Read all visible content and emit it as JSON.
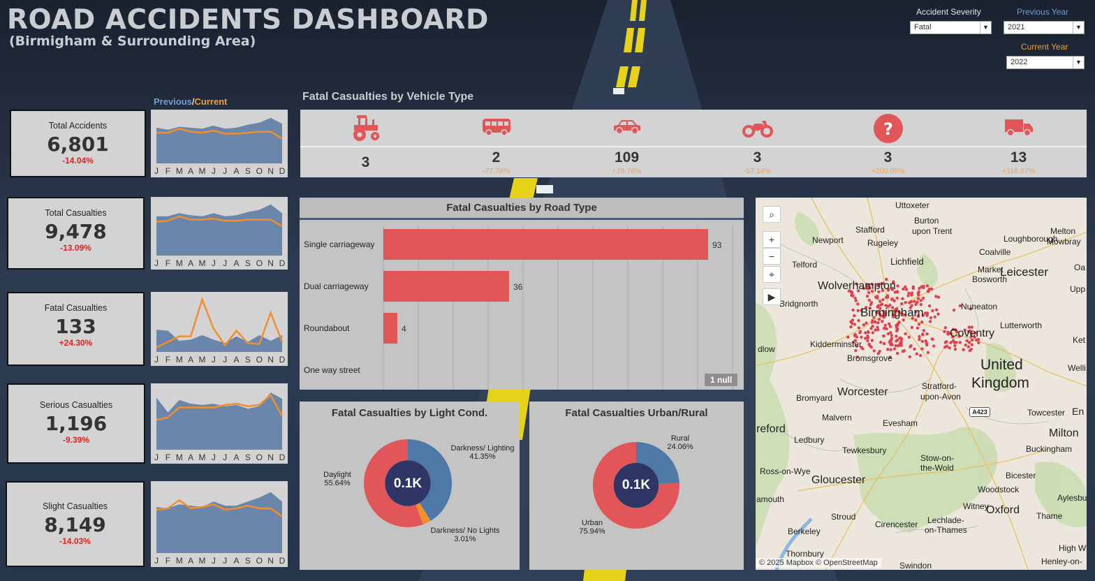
{
  "header": {
    "title": "ROAD ACCIDENTS DASHBOARD",
    "subtitle": "(Birmigham & Surrounding Area)"
  },
  "filters": {
    "severity": {
      "label": "Accident Severity",
      "value": "Fatal"
    },
    "previous_year": {
      "label": "Previous Year",
      "value": "2021"
    },
    "current_year": {
      "label": "Current Year",
      "value": "2022"
    }
  },
  "legend": {
    "previous": "Previous",
    "sep": "/",
    "current": "Current"
  },
  "months": [
    "J",
    "F",
    "M",
    "A",
    "M",
    "J",
    "J",
    "A",
    "S",
    "O",
    "N",
    "D"
  ],
  "kpis": [
    {
      "title": "Total Accidents",
      "value": "6,801",
      "change": "-14.04%",
      "prev": [
        0.72,
        0.68,
        0.74,
        0.72,
        0.7,
        0.76,
        0.7,
        0.72,
        0.78,
        0.82,
        0.92,
        0.8
      ],
      "curr": [
        0.62,
        0.62,
        0.7,
        0.64,
        0.62,
        0.66,
        0.6,
        0.6,
        0.62,
        0.64,
        0.64,
        0.5
      ]
    },
    {
      "title": "Total Casualties",
      "value": "9,478",
      "change": "-13.09%",
      "prev": [
        0.72,
        0.72,
        0.78,
        0.74,
        0.72,
        0.78,
        0.72,
        0.74,
        0.8,
        0.84,
        0.94,
        0.78
      ],
      "curr": [
        0.62,
        0.64,
        0.72,
        0.66,
        0.66,
        0.68,
        0.64,
        0.64,
        0.66,
        0.66,
        0.66,
        0.54
      ]
    },
    {
      "title": "Fatal Casualties",
      "value": "133",
      "change": "+24.30%",
      "prev": [
        0.4,
        0.38,
        0.2,
        0.22,
        0.3,
        0.22,
        0.16,
        0.28,
        0.18,
        0.3,
        0.2,
        0.3
      ],
      "curr": [
        0.08,
        0.18,
        0.28,
        0.28,
        0.94,
        0.42,
        0.12,
        0.38,
        0.16,
        0.14,
        0.7,
        0.18
      ]
    },
    {
      "title": "Serious Casualties",
      "value": "1,196",
      "change": "-9.39%",
      "prev": [
        0.84,
        0.6,
        0.8,
        0.74,
        0.72,
        0.74,
        0.7,
        0.72,
        0.66,
        0.7,
        0.92,
        0.82
      ],
      "curr": [
        0.48,
        0.52,
        0.68,
        0.68,
        0.68,
        0.68,
        0.72,
        0.74,
        0.7,
        0.72,
        0.88,
        0.54
      ]
    },
    {
      "title": "Slight Casualties",
      "value": "8,149",
      "change": "-14.03%",
      "prev": [
        0.68,
        0.66,
        0.72,
        0.7,
        0.68,
        0.76,
        0.7,
        0.7,
        0.76,
        0.82,
        0.9,
        0.76
      ],
      "curr": [
        0.64,
        0.66,
        0.78,
        0.66,
        0.68,
        0.72,
        0.64,
        0.66,
        0.7,
        0.66,
        0.66,
        0.54
      ]
    }
  ],
  "vehicle": {
    "title": "Fatal Casualties by Vehicle Type",
    "items": [
      {
        "icon": "tractor-icon",
        "value": "3",
        "change": ""
      },
      {
        "icon": "bus-icon",
        "value": "2",
        "change": "-77.78%"
      },
      {
        "icon": "car-icon",
        "value": "109",
        "change": "+29.76%"
      },
      {
        "icon": "motorcycle-icon",
        "value": "3",
        "change": "-57.14%"
      },
      {
        "icon": "question-icon",
        "value": "3",
        "change": "+200.00%"
      },
      {
        "icon": "truck-icon",
        "value": "13",
        "change": "+116.67%"
      }
    ]
  },
  "chart_data": [
    {
      "type": "bar",
      "title": "Fatal Casualties by Road Type",
      "categories": [
        "Single carriageway",
        "Dual carriageway",
        "Roundabout",
        "One way street"
      ],
      "values": [
        93,
        36,
        4,
        null
      ],
      "xlim": [
        0,
        100
      ],
      "null_badge": "1 null"
    },
    {
      "type": "pie",
      "title": "Fatal Casualties by Light Cond.",
      "center_label": "0.1K",
      "slices": [
        {
          "label": "Darkness/ Lighting",
          "pct": "41.35%",
          "value": 41.35,
          "color": "#4e79a7"
        },
        {
          "label": "Darkness/ No Lights",
          "pct": "3.01%",
          "value": 3.01,
          "color": "#f28e2b"
        },
        {
          "label": "Daylight",
          "pct": "55.64%",
          "value": 55.64,
          "color": "#e15759"
        }
      ]
    },
    {
      "type": "pie",
      "title": "Fatal Casualties Urban/Rural",
      "center_label": "0.1K",
      "slices": [
        {
          "label": "Rural",
          "pct": "24.06%",
          "value": 24.06,
          "color": "#4e79a7"
        },
        {
          "label": "Urban",
          "pct": "75.94%",
          "value": 75.94,
          "color": "#e15759"
        }
      ]
    }
  ],
  "map": {
    "attribution": "© 2025 Mapbox © OpenStreetMap",
    "labels": [
      {
        "t": "Uttoxeter",
        "x": 200,
        "y": 4,
        "s": 12
      },
      {
        "t": "Stafford",
        "x": 143,
        "y": 39,
        "s": 12
      },
      {
        "t": "Burton",
        "x": 227,
        "y": 26,
        "s": 12
      },
      {
        "t": "upon Trent",
        "x": 224,
        "y": 41,
        "s": 12
      },
      {
        "t": "Melton",
        "x": 422,
        "y": 41,
        "s": 12
      },
      {
        "t": "Mowbray",
        "x": 417,
        "y": 56,
        "s": 12
      },
      {
        "t": "Newport",
        "x": 81,
        "y": 54,
        "s": 12
      },
      {
        "t": "Rugeley",
        "x": 160,
        "y": 58,
        "s": 12
      },
      {
        "t": "Loughborough",
        "x": 355,
        "y": 52,
        "s": 12
      },
      {
        "t": "Coalville",
        "x": 320,
        "y": 71,
        "s": 12
      },
      {
        "t": "Lichfield",
        "x": 193,
        "y": 84,
        "s": 13
      },
      {
        "t": "Telford",
        "x": 52,
        "y": 89,
        "s": 12
      },
      {
        "t": "Market",
        "x": 318,
        "y": 96,
        "s": 12
      },
      {
        "t": "Bosworth",
        "x": 310,
        "y": 110,
        "s": 12
      },
      {
        "t": "Leicester",
        "x": 350,
        "y": 97,
        "s": 17
      },
      {
        "t": "Oa",
        "x": 456,
        "y": 93,
        "s": 12
      },
      {
        "t": "Wolverhampton",
        "x": 89,
        "y": 118,
        "s": 16
      },
      {
        "t": "Upp",
        "x": 450,
        "y": 124,
        "s": 12
      },
      {
        "t": "Bridgnorth",
        "x": 34,
        "y": 145,
        "s": 12
      },
      {
        "t": "Nuneaton",
        "x": 294,
        "y": 149,
        "s": 12
      },
      {
        "t": "Birmingham",
        "x": 150,
        "y": 155,
        "s": 17
      },
      {
        "t": "Lutterworth",
        "x": 350,
        "y": 176,
        "s": 12
      },
      {
        "t": "Coventry",
        "x": 278,
        "y": 186,
        "s": 16
      },
      {
        "t": "Ket",
        "x": 454,
        "y": 197,
        "s": 12
      },
      {
        "t": "Kidderminster",
        "x": 78,
        "y": 203,
        "s": 12
      },
      {
        "t": "dlow",
        "x": 3,
        "y": 210,
        "s": 12
      },
      {
        "t": "Bromsgrove",
        "x": 131,
        "y": 223,
        "s": 12
      },
      {
        "t": "United",
        "x": 322,
        "y": 228,
        "s": 21
      },
      {
        "t": "Kingdom",
        "x": 309,
        "y": 254,
        "s": 21
      },
      {
        "t": "Welli",
        "x": 447,
        "y": 237,
        "s": 12
      },
      {
        "t": "Stratford-",
        "x": 238,
        "y": 263,
        "s": 12
      },
      {
        "t": "upon-Avon",
        "x": 236,
        "y": 278,
        "s": 12
      },
      {
        "t": "Bromyard",
        "x": 58,
        "y": 280,
        "s": 12
      },
      {
        "t": "Worcester",
        "x": 117,
        "y": 270,
        "s": 16
      },
      {
        "t": "Towcester",
        "x": 389,
        "y": 301,
        "s": 12
      },
      {
        "t": "En",
        "x": 453,
        "y": 298,
        "s": 14
      },
      {
        "t": "Malvern",
        "x": 95,
        "y": 308,
        "s": 12
      },
      {
        "t": "reford",
        "x": 1,
        "y": 323,
        "s": 16
      },
      {
        "t": "Evesham",
        "x": 182,
        "y": 316,
        "s": 12
      },
      {
        "t": "Milton",
        "x": 420,
        "y": 329,
        "s": 16
      },
      {
        "t": "Ledbury",
        "x": 55,
        "y": 340,
        "s": 12
      },
      {
        "t": "Tewkesbury",
        "x": 124,
        "y": 355,
        "s": 12
      },
      {
        "t": "Buckingham",
        "x": 387,
        "y": 353,
        "s": 12
      },
      {
        "t": "Stow-on-",
        "x": 236,
        "y": 366,
        "s": 12
      },
      {
        "t": "the-Wold",
        "x": 236,
        "y": 380,
        "s": 12
      },
      {
        "t": "Ross-on-Wye",
        "x": 6,
        "y": 385,
        "s": 12
      },
      {
        "t": "Bicester",
        "x": 358,
        "y": 391,
        "s": 12
      },
      {
        "t": "Gloucester",
        "x": 80,
        "y": 396,
        "s": 16
      },
      {
        "t": "Woodstock",
        "x": 318,
        "y": 411,
        "s": 12
      },
      {
        "t": "Aylesbu",
        "x": 432,
        "y": 423,
        "s": 12
      },
      {
        "t": "amouth",
        "x": 1,
        "y": 425,
        "s": 12
      },
      {
        "t": "Witney",
        "x": 297,
        "y": 435,
        "s": 12
      },
      {
        "t": "Oxford",
        "x": 330,
        "y": 439,
        "s": 16
      },
      {
        "t": "Stroud",
        "x": 108,
        "y": 450,
        "s": 12
      },
      {
        "t": "Cirencester",
        "x": 171,
        "y": 461,
        "s": 12
      },
      {
        "t": "Lechlade-",
        "x": 246,
        "y": 455,
        "s": 12
      },
      {
        "t": "on-Thames",
        "x": 242,
        "y": 469,
        "s": 12
      },
      {
        "t": "Thame",
        "x": 402,
        "y": 449,
        "s": 12
      },
      {
        "t": "Berkeley",
        "x": 46,
        "y": 471,
        "s": 12
      },
      {
        "t": "Thornbury",
        "x": 43,
        "y": 503,
        "s": 12
      },
      {
        "t": "High W",
        "x": 434,
        "y": 495,
        "s": 12
      },
      {
        "t": "Swindon",
        "x": 206,
        "y": 520,
        "s": 12
      },
      {
        "t": "Henley-on-",
        "x": 409,
        "y": 514,
        "s": 12
      }
    ],
    "road_badge": "A423"
  }
}
